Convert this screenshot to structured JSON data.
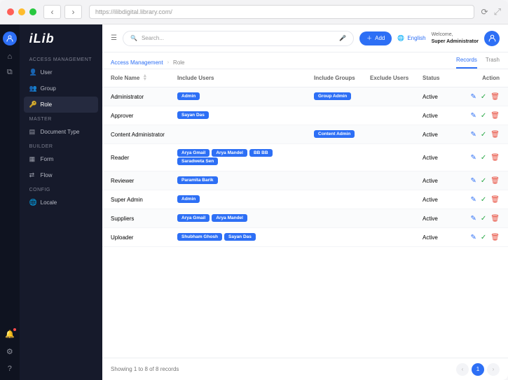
{
  "browser": {
    "url": "https://ilibdigital.library.com/"
  },
  "app_logo": "iLib",
  "sidebar": {
    "sections": [
      {
        "title": "ACCESS MANAGEMENT",
        "items": [
          {
            "icon": "user-icon",
            "label": "User"
          },
          {
            "icon": "users-icon",
            "label": "Group"
          },
          {
            "icon": "key-icon",
            "label": "Role",
            "active": true
          }
        ]
      },
      {
        "title": "MASTER",
        "items": [
          {
            "icon": "doc-icon",
            "label": "Document Type"
          }
        ]
      },
      {
        "title": "BUILDER",
        "items": [
          {
            "icon": "form-icon",
            "label": "Form"
          },
          {
            "icon": "flow-icon",
            "label": "Flow"
          }
        ]
      },
      {
        "title": "CONFIG",
        "items": [
          {
            "icon": "globe-icon",
            "label": "Locale"
          }
        ]
      }
    ]
  },
  "topbar": {
    "search_placeholder": "Search...",
    "add_label": "Add",
    "language": "English",
    "welcome_label": "Welcome,",
    "user_name": "Super Administrator"
  },
  "breadcrumb": {
    "parent": "Access Management",
    "current": "Role"
  },
  "tabs": {
    "records": "Records",
    "trash": "Trash"
  },
  "table": {
    "columns": {
      "role_name": "Role Name",
      "include_users": "Include Users",
      "include_groups": "Include Groups",
      "exclude_users": "Exclude Users",
      "status": "Status",
      "action": "Action"
    },
    "rows": [
      {
        "name": "Administrator",
        "include_users": [
          "Admin"
        ],
        "include_groups": [
          "Group Admin"
        ],
        "exclude_users": [],
        "status": "Active"
      },
      {
        "name": "Approver",
        "include_users": [
          "Sayan Das"
        ],
        "include_groups": [],
        "exclude_users": [],
        "status": "Active"
      },
      {
        "name": "Content Administrator",
        "include_users": [],
        "include_groups": [
          "Content Admin"
        ],
        "exclude_users": [],
        "status": "Active"
      },
      {
        "name": "Reader",
        "include_users": [
          "Arya Gmail",
          "Arya Mandel",
          "BB BB",
          "Saradweta Sen"
        ],
        "include_groups": [],
        "exclude_users": [],
        "status": "Active"
      },
      {
        "name": "Reviewer",
        "include_users": [
          "Paramita Barik"
        ],
        "include_groups": [],
        "exclude_users": [],
        "status": "Active"
      },
      {
        "name": "Super Admin",
        "include_users": [
          "Admin"
        ],
        "include_groups": [],
        "exclude_users": [],
        "status": "Active"
      },
      {
        "name": "Suppliers",
        "include_users": [
          "Arya Gmail",
          "Arya Mandel"
        ],
        "include_groups": [],
        "exclude_users": [],
        "status": "Active"
      },
      {
        "name": "Uploader",
        "include_users": [
          "Shubham Ghosh",
          "Sayan Das"
        ],
        "include_groups": [],
        "exclude_users": [],
        "status": "Active"
      }
    ]
  },
  "footer": {
    "summary": "Showing 1 to 8 of 8 records",
    "current_page": "1"
  }
}
